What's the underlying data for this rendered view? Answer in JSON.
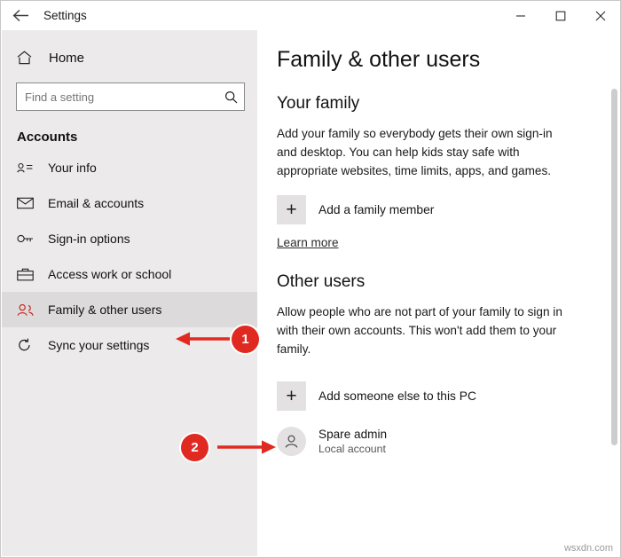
{
  "window": {
    "title": "Settings",
    "back_icon": "back-arrow-icon",
    "minimize_label": "Minimize",
    "maximize_label": "Maximize",
    "close_label": "Close"
  },
  "sidebar": {
    "home_label": "Home",
    "search": {
      "placeholder": "Find a setting",
      "value": "",
      "icon": "search-icon"
    },
    "section_title": "Accounts",
    "items": [
      {
        "label": "Your info",
        "icon": "person-card-icon",
        "selected": false
      },
      {
        "label": "Email & accounts",
        "icon": "mail-icon",
        "selected": false
      },
      {
        "label": "Sign-in options",
        "icon": "key-icon",
        "selected": false
      },
      {
        "label": "Access work or school",
        "icon": "briefcase-icon",
        "selected": false
      },
      {
        "label": "Family & other users",
        "icon": "people-icon",
        "selected": true
      },
      {
        "label": "Sync your settings",
        "icon": "sync-icon",
        "selected": false
      }
    ]
  },
  "content": {
    "page_title": "Family & other users",
    "family": {
      "heading": "Your family",
      "description": "Add your family so everybody gets their own sign-in and desktop. You can help kids stay safe with appropriate websites, time limits, apps, and games.",
      "add_button": "Add a family member",
      "learn_more": "Learn more"
    },
    "other_users": {
      "heading": "Other users",
      "description": "Allow people who are not part of your family to sign in with their own accounts. This won't add them to your family.",
      "add_button": "Add someone else to this PC",
      "user": {
        "name": "Spare admin",
        "type": "Local account",
        "avatar_icon": "user-avatar-icon"
      }
    }
  },
  "annotations": {
    "callouts": [
      {
        "number": "1",
        "target": "Family & other users"
      },
      {
        "number": "2",
        "target": "Add someone else to this PC"
      }
    ],
    "accent_color": "#e02a21"
  },
  "watermark": "wsxdn.com"
}
